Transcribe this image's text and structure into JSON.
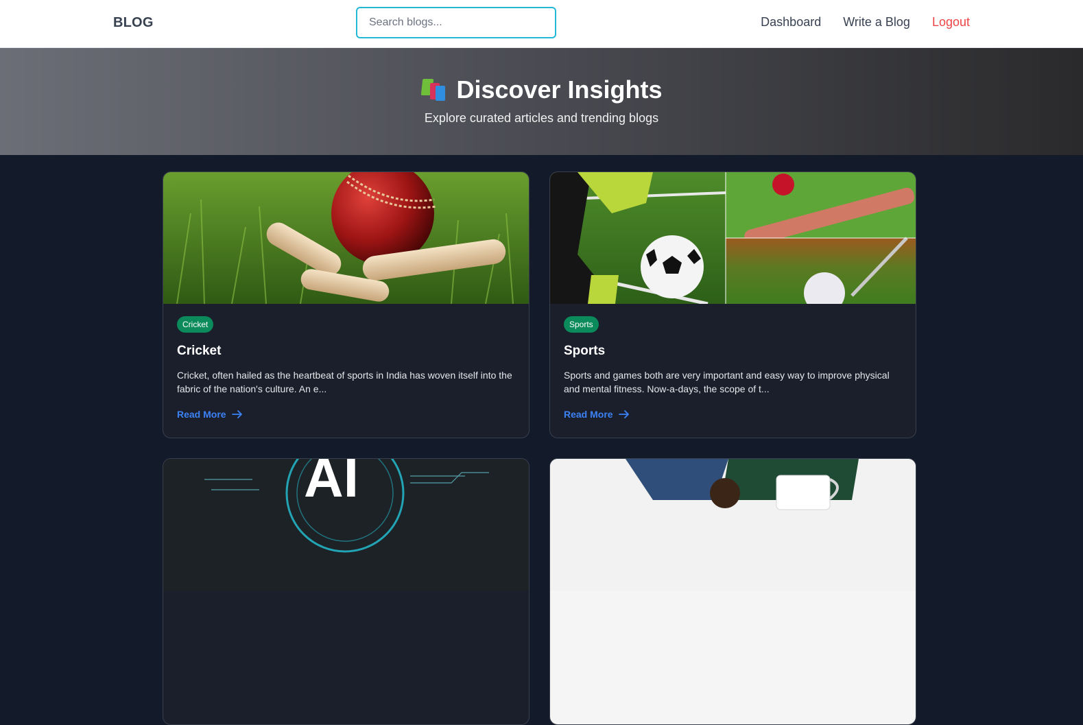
{
  "nav": {
    "brand": "BLOG",
    "search_placeholder": "Search blogs...",
    "links": [
      "Dashboard",
      "Write a Blog",
      "Logout"
    ]
  },
  "hero": {
    "icon": "books-icon",
    "title": "Discover Insights",
    "subtitle": "Explore curated articles and trending blogs"
  },
  "cards": [
    {
      "tag": "Cricket",
      "title": "Cricket",
      "desc": "Cricket, often hailed as the heartbeat of sports in India has woven itself into the fabric of the nation's culture. An e...",
      "read_more": "Read More"
    },
    {
      "tag": "Sports",
      "title": "Sports",
      "desc": "Sports and games both are very important and easy way to improve physical and mental fitness. Now-a-days, the scope of t...",
      "read_more": "Read More"
    },
    {
      "image_text": "AI"
    },
    {}
  ],
  "colors": {
    "accent": "#22b8d6",
    "tag": "#0b8a5c",
    "link": "#3b82f6",
    "logout": "#ef4444"
  }
}
